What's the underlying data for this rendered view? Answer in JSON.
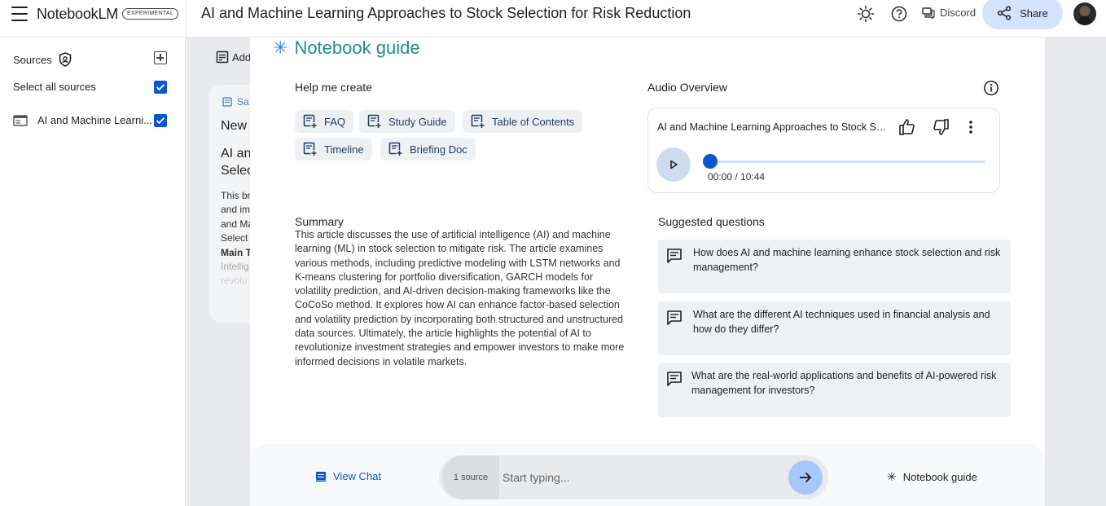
{
  "header": {
    "brand": "NotebookLM",
    "badge": "EXPERIMENTAL",
    "title": "AI and Machine Learning Approaches to Stock Selection for Risk Reduction",
    "discord_label": "Discord",
    "share_label": "Share"
  },
  "sidebar": {
    "sources_label": "Sources",
    "select_all_label": "Select all sources",
    "items": [
      {
        "label": "AI and Machine Learni..."
      }
    ]
  },
  "notes": {
    "add_note_label": "Add",
    "card": {
      "label": "Sa",
      "new_label": "New",
      "title_line1": "AI and",
      "title_line2": "Selec",
      "body_lines": [
        "This br",
        "and im",
        "and Ma",
        "Select",
        "Main T",
        "Intellig",
        "revolu"
      ]
    }
  },
  "guide": {
    "title": "Notebook guide",
    "help_create_label": "Help me create",
    "chips": [
      {
        "label": "FAQ"
      },
      {
        "label": "Study Guide"
      },
      {
        "label": "Table of Contents"
      },
      {
        "label": "Timeline"
      },
      {
        "label": "Briefing Doc"
      }
    ],
    "summary_heading": "Summary",
    "summary_text": "This article discusses the use of artificial intelligence (AI) and machine learning (ML) in stock selection to mitigate risk. The article examines various methods, including predictive modeling with LSTM networks and K-means clustering for portfolio diversification, GARCH models for volatility prediction, and AI-driven decision-making frameworks like the CoCoSo method. It explores how AI can enhance factor-based selection and volatility prediction by incorporating both structured and unstructured data sources. Ultimately, the article highlights the potential of AI to revolutionize investment strategies and empower investors to make more informed decisions in volatile markets.",
    "audio_overview_label": "Audio Overview",
    "audio": {
      "title": "AI and Machine Learning Approaches to Stock Selection for Risk Reduction",
      "time": "00:00 / 10:44",
      "progress": 0
    },
    "suggested_label": "Suggested questions",
    "questions": [
      {
        "text": "How does AI and machine learning enhance stock selection and risk management?"
      },
      {
        "text": "What are the different AI techniques used in financial analysis and how do they differ?"
      },
      {
        "text": "What are the real-world applications and benefits of AI-powered risk management for investors?"
      }
    ]
  },
  "bottom": {
    "view_chat_label": "View Chat",
    "source_count": "1 source",
    "input_placeholder": "Start typing...",
    "notebook_guide_label": "Notebook guide"
  },
  "colors": {
    "accent": "#0b57d0",
    "guide_title": "#1e8e8e",
    "share_bg": "#d3e3fd"
  }
}
